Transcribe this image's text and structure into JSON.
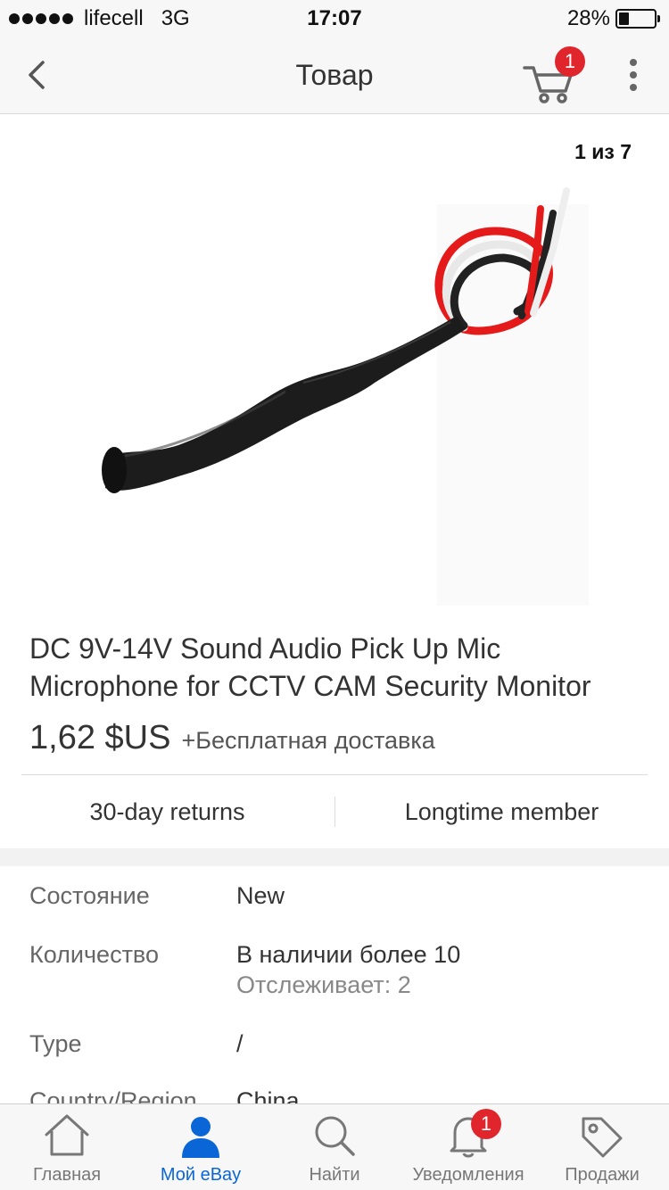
{
  "status_bar": {
    "carrier": "lifecell",
    "network": "3G",
    "time": "17:07",
    "battery_percent": "28%",
    "battery_level": 0.28
  },
  "nav": {
    "title": "Товар",
    "cart_count": "1",
    "icons": [
      "back-chevron-icon",
      "cart-icon",
      "more-vertical-icon"
    ]
  },
  "gallery": {
    "counter": "1 из 7"
  },
  "product": {
    "title": "DC 9V-14V Sound Audio Pick Up Mic Microphone for CCTV CAM Security Monitor",
    "price": "1,62 $US",
    "shipping": "+Бесплатная доставка"
  },
  "badges": {
    "returns": "30-day returns",
    "member": "Longtime member"
  },
  "specs": [
    {
      "label": "Состояние",
      "value": "New"
    },
    {
      "label": "Количество",
      "value": "В наличии более 10",
      "sub": "Отслеживает: 2"
    },
    {
      "label": "Type",
      "value": "/"
    },
    {
      "label": "Country/Region",
      "value": "China"
    }
  ],
  "tab_bar": {
    "tabs": [
      {
        "label": "Главная",
        "icon": "home-icon"
      },
      {
        "label": "Мой eBay",
        "icon": "user-icon"
      },
      {
        "label": "Найти",
        "icon": "search-icon"
      },
      {
        "label": "Уведомления",
        "icon": "bell-icon"
      },
      {
        "label": "Продажи",
        "icon": "tag-icon"
      }
    ],
    "active": "Мой eBay",
    "notifications_count": "1"
  },
  "colors": {
    "accent": "#0a66d6",
    "badge_red": "#e0262c"
  }
}
